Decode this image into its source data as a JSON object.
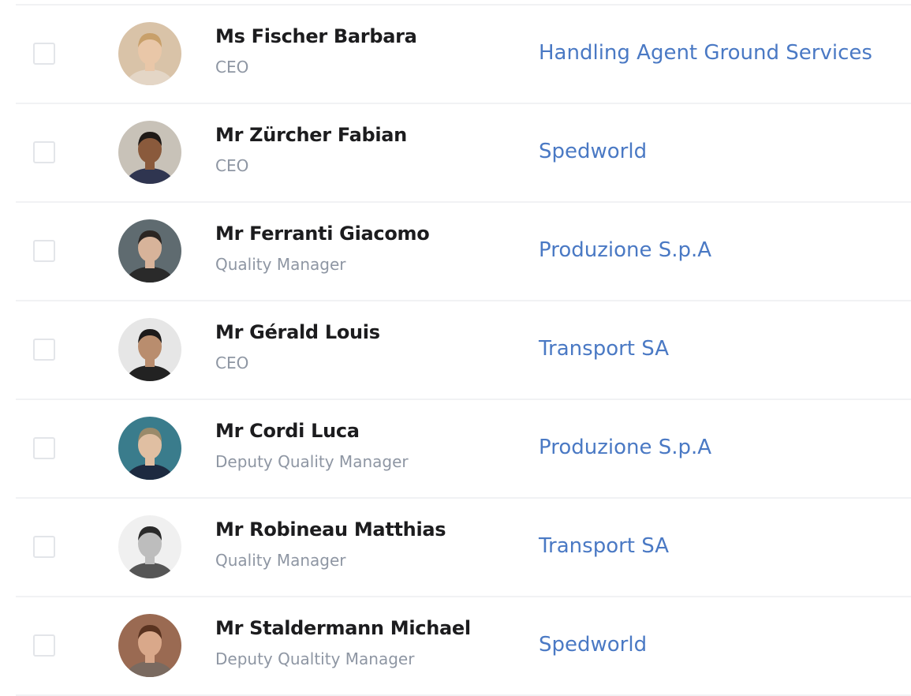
{
  "contacts": [
    {
      "name": "Ms Fischer Barbara",
      "role": "CEO",
      "company": "Handling Agent Ground Services",
      "avatar_bg": "#d9c3a8",
      "hair": "#c8a06a",
      "skin": "#e9c7a8",
      "cloth": "#e4d6c6",
      "avatar_icon": "person-photo"
    },
    {
      "name": "Mr Zürcher Fabian",
      "role": "CEO",
      "company": "Spedworld",
      "avatar_bg": "#c8c2b8",
      "hair": "#1f1a17",
      "skin": "#8a5a3c",
      "cloth": "#2f3550",
      "avatar_icon": "person-photo"
    },
    {
      "name": "Mr Ferranti Giacomo",
      "role": "Quality Manager",
      "company": "Produzione S.p.A",
      "avatar_bg": "#5f6b70",
      "hair": "#2b2522",
      "skin": "#d7b39a",
      "cloth": "#2a2a2a",
      "avatar_icon": "person-photo"
    },
    {
      "name": "Mr Gérald Louis",
      "role": "CEO",
      "company": "Transport SA",
      "avatar_bg": "#e6e6e6",
      "hair": "#1c1a1a",
      "skin": "#b98d6e",
      "cloth": "#222222",
      "avatar_icon": "person-photo"
    },
    {
      "name": "Mr Cordi Luca",
      "role": "Deputy Quality Manager",
      "company": "Produzione S.p.A",
      "avatar_bg": "#3a7c8c",
      "hair": "#9a8a6a",
      "skin": "#e0bfa2",
      "cloth": "#1d2a40",
      "avatar_icon": "person-photo"
    },
    {
      "name": "Mr Robineau Matthias",
      "role": "Quality Manager",
      "company": "Transport SA",
      "avatar_bg": "#f0f0f0",
      "hair": "#2a2a2a",
      "skin": "#bdbdbd",
      "cloth": "#555555",
      "avatar_icon": "person-photo"
    },
    {
      "name": "Mr Staldermann Michael",
      "role": "Deputy Qualtity Manager",
      "company": "Spedworld",
      "avatar_bg": "#9a6a52",
      "hair": "#5a3320",
      "skin": "#d9a88a",
      "cloth": "#7a6a60",
      "avatar_icon": "person-photo"
    }
  ],
  "colors": {
    "name": "#1c1c1e",
    "role": "#8e96a3",
    "company_link": "#4a79c4",
    "divider": "#f1f2f4",
    "checkbox_border": "#e3e5e9"
  }
}
